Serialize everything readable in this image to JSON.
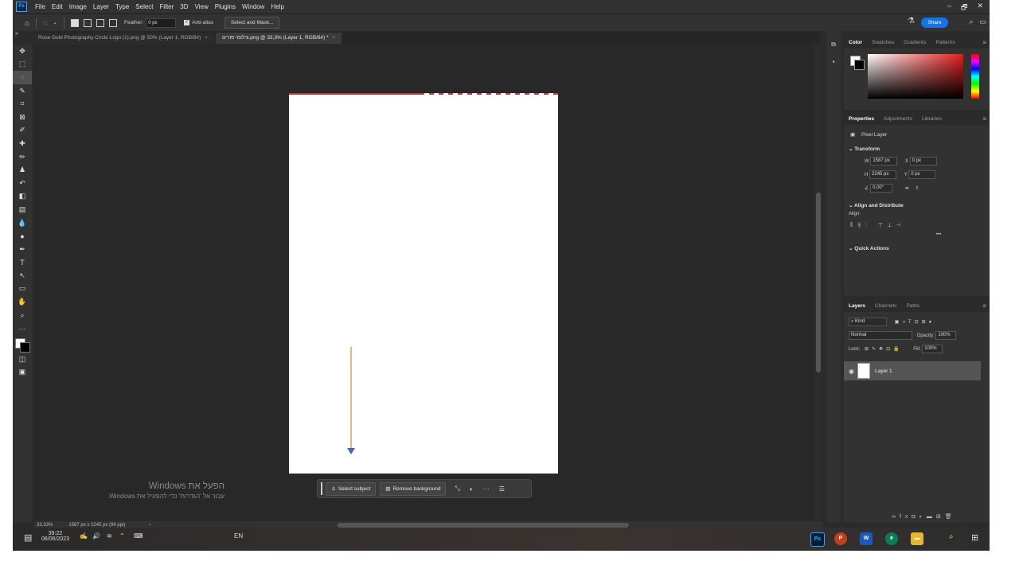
{
  "menubar": {
    "app_icon": "Ps",
    "items": [
      "File",
      "Edit",
      "Image",
      "Layer",
      "Type",
      "Select",
      "Filter",
      "3D",
      "View",
      "Plugins",
      "Window",
      "Help"
    ],
    "window_controls": [
      "–",
      "🗗",
      "✕"
    ]
  },
  "options": {
    "feather_label": "Feather:",
    "feather_value": "0 px",
    "antialias_label": "Anti-alias",
    "select_mask_label": "Select and Mask...",
    "share_label": "Share"
  },
  "tabs": [
    {
      "label": "Rose Gold Photography Circle Logo (1).png @ 50% (Layer 1, RGB/8#)",
      "close": "×"
    },
    {
      "label": "צילומי פורים.png @ 33,3% (Layer 1, RGB/8#) *",
      "close": "×"
    }
  ],
  "context_bar": {
    "select_subject": "Select subject",
    "remove_background": "Remove background"
  },
  "watermark": {
    "line1": "הפעל את Windows",
    "line2": "עבור אל 'הגדרות' כדי להפעיל את Windows."
  },
  "status": {
    "zoom": "33,33%",
    "doc_info": "1587 px x 2245 px (96 ppi)"
  },
  "color_panel": {
    "tabs": [
      "Color",
      "Swatches",
      "Gradients",
      "Patterns"
    ]
  },
  "properties_panel": {
    "tabs": [
      "Properties",
      "Adjustments",
      "Libraries"
    ],
    "layer_type": "Pixel Layer",
    "transform_label": "Transform",
    "w_label": "W",
    "w_value": "1587 px",
    "h_label": "H",
    "h_value": "2245 px",
    "x_label": "X",
    "x_value": "0 px",
    "y_label": "Y",
    "y_value": "0 px",
    "angle_value": "0,00°",
    "align_label": "Align and Distribute",
    "align_sub": "Align:",
    "more": "•••",
    "quick_actions": "Quick Actions"
  },
  "layers_panel": {
    "tabs": [
      "Layers",
      "Channels",
      "Paths"
    ],
    "kind": "Kind",
    "blend_mode": "Normal",
    "opacity_label": "Opacity:",
    "opacity_value": "100%",
    "lock_label": "Lock:",
    "fill_label": "Fill:",
    "fill_value": "100%",
    "layers": [
      {
        "name": "Layer 1"
      }
    ]
  },
  "taskbar": {
    "time": "39:22",
    "date": "06/06/2023",
    "lang": "EN"
  }
}
